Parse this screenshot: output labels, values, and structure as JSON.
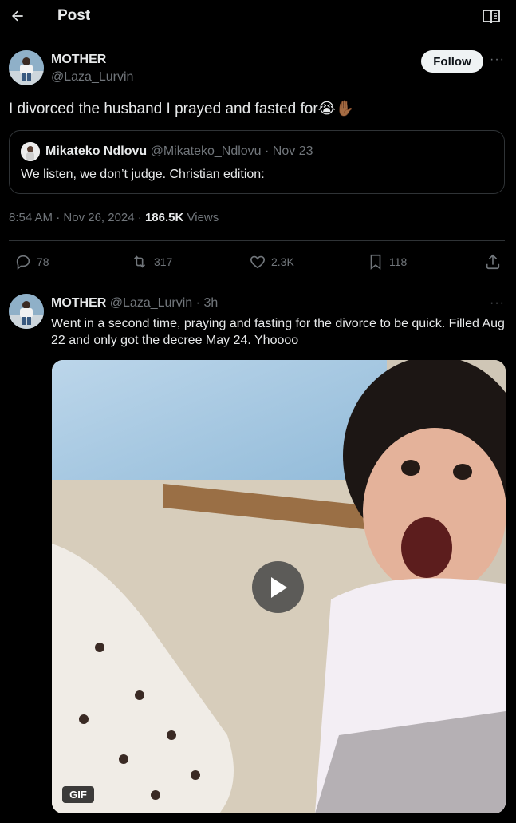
{
  "header": {
    "title": "Post",
    "back_icon": "back-arrow-icon",
    "reader_icon": "reader-mode-icon"
  },
  "main_post": {
    "author_name": "MOTHER",
    "author_handle": "@Laza_Lurvin",
    "follow_label": "Follow",
    "more_icon": "more-options-icon",
    "text": "I divorced the husband I prayed and fasted for",
    "emoji": [
      "😭",
      "✋🏾"
    ],
    "quote": {
      "author_name": "Mikateko Ndlovu",
      "author_handle": "@Mikateko_Ndlovu",
      "separator": "·",
      "date": "Nov 23",
      "text": "We listen, we don’t judge. Christian edition:"
    },
    "meta": {
      "time": "8:54 AM",
      "separator": "·",
      "date": "Nov 26, 2024",
      "views_count": "186.5K",
      "views_label": "Views"
    },
    "actions": {
      "replies": "78",
      "reposts": "317",
      "likes": "2.3K",
      "bookmarks": "118"
    }
  },
  "reply_post": {
    "author_name": "MOTHER",
    "author_handle": "@Laza_Lurvin",
    "separator": "·",
    "time": "3h",
    "text": "Went in a second time, praying and fasting for the divorce to be quick. Filled Aug 22 and only got the decree May 24. Yhoooo",
    "media_badge": "GIF"
  },
  "colors": {
    "background": "#000000",
    "text": "#e7e9ea",
    "muted": "#71767b",
    "border": "#2f3336",
    "follow_bg": "#eff3f4"
  }
}
